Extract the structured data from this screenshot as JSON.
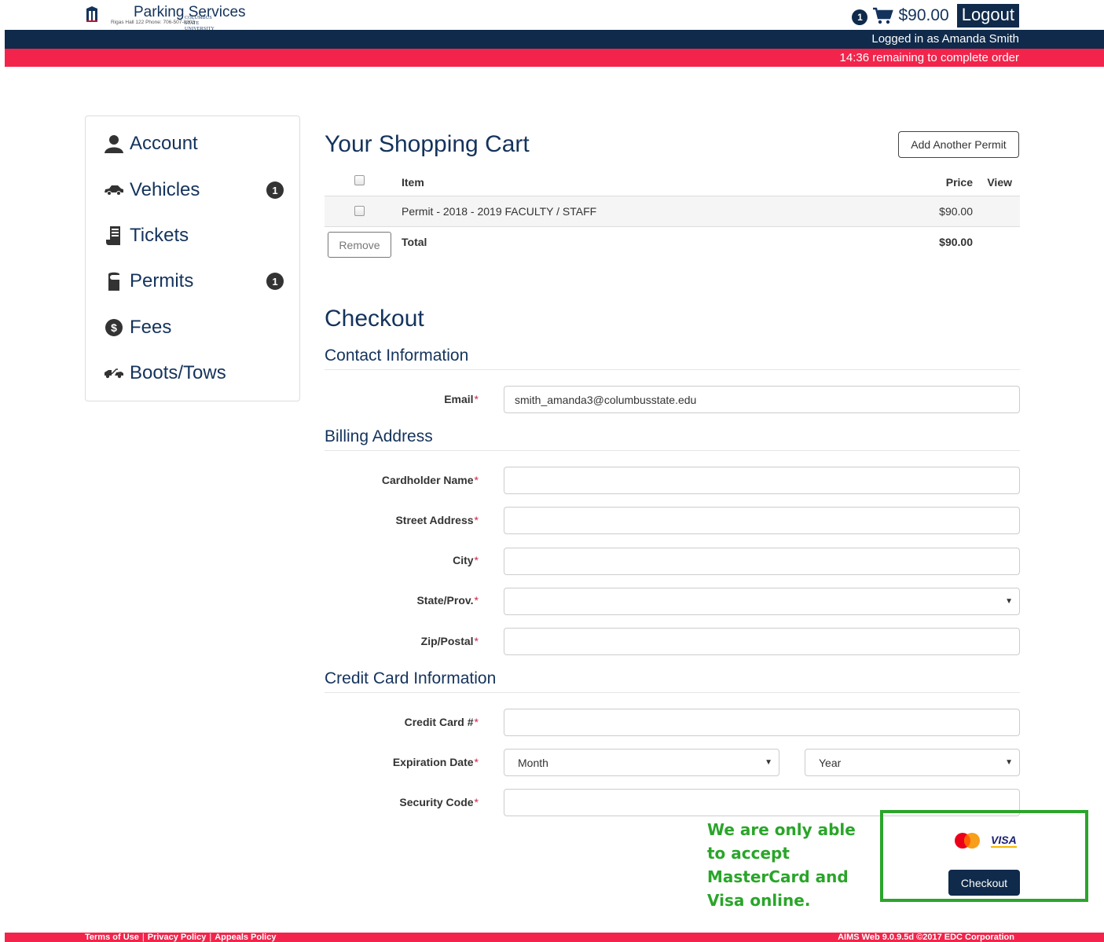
{
  "header": {
    "logo_university": "COLUMBUS STATE UNIVERSITY",
    "app_title": "Parking Services",
    "contact": "Rigas Hall 122 Phone: 706-507-8203",
    "cart_count": "1",
    "cart_total": "$90.00",
    "logout_label": "Logout",
    "logged_in_text": "Logged in as Amanda Smith",
    "timer_text": "14:36 remaining to complete order"
  },
  "sidebar": {
    "items": [
      {
        "label": "Account",
        "icon": "user-icon",
        "badge": ""
      },
      {
        "label": "Vehicles",
        "icon": "car-icon",
        "badge": "1"
      },
      {
        "label": "Tickets",
        "icon": "ticket-icon",
        "badge": ""
      },
      {
        "label": "Permits",
        "icon": "permit-hangtag-icon",
        "badge": "1"
      },
      {
        "label": "Fees",
        "icon": "dollar-icon",
        "badge": ""
      },
      {
        "label": "Boots/Tows",
        "icon": "tow-truck-icon",
        "badge": ""
      }
    ]
  },
  "cart": {
    "title": "Your Shopping Cart",
    "add_button": "Add Another Permit",
    "columns": {
      "item": "Item",
      "price": "Price",
      "view": "View"
    },
    "items": [
      {
        "name": "Permit - 2018 - 2019 FACULTY / STAFF",
        "price": "$90.00"
      }
    ],
    "remove_label": "Remove",
    "total_label": "Total",
    "total_value": "$90.00"
  },
  "checkout": {
    "title": "Checkout",
    "contact_section": "Contact Information",
    "billing_section": "Billing Address",
    "credit_section": "Credit Card Information",
    "required_mark": "*",
    "fields": {
      "email_label": "Email",
      "email_value": "smith_amanda3@columbusstate.edu",
      "cardholder_label": "Cardholder Name",
      "street_label": "Street Address",
      "city_label": "City",
      "state_label": "State/Prov.",
      "zip_label": "Zip/Postal",
      "card_number_label": "Credit Card #",
      "expiration_label": "Expiration Date",
      "month_value": "Month",
      "year_value": "Year",
      "security_label": "Security Code"
    },
    "card_note": "We are only able to accept MasterCard and Visa online.",
    "mastercard_label": "MasterCard",
    "visa_label": "VISA",
    "checkout_button": "Checkout"
  },
  "footer": {
    "links": [
      "Terms of Use",
      "Privacy Policy",
      "Appeals Policy"
    ],
    "separator": "|",
    "version": "AIMS Web 9.0.9.5d ©2017 EDC Corporation"
  },
  "colors": {
    "navy": "#0f2a4a",
    "title_blue": "#14335c",
    "alert_red": "#f2244b",
    "note_green": "#2aa52a"
  }
}
